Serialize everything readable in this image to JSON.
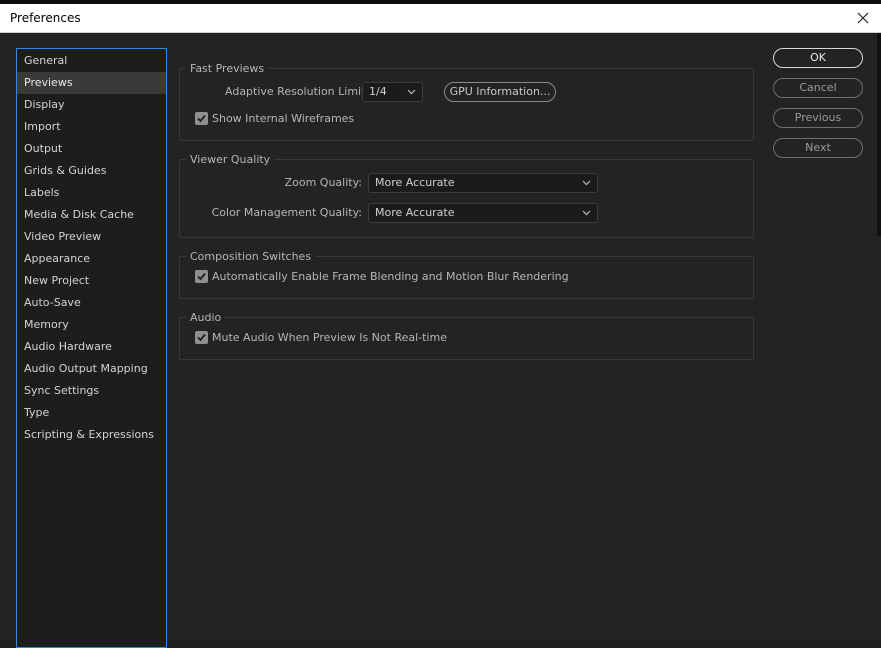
{
  "window": {
    "title": "Preferences"
  },
  "sidebar": {
    "items": [
      {
        "label": "General"
      },
      {
        "label": "Previews"
      },
      {
        "label": "Display"
      },
      {
        "label": "Import"
      },
      {
        "label": "Output"
      },
      {
        "label": "Grids & Guides"
      },
      {
        "label": "Labels"
      },
      {
        "label": "Media & Disk Cache"
      },
      {
        "label": "Video Preview"
      },
      {
        "label": "Appearance"
      },
      {
        "label": "New Project"
      },
      {
        "label": "Auto-Save"
      },
      {
        "label": "Memory"
      },
      {
        "label": "Audio Hardware"
      },
      {
        "label": "Audio Output Mapping"
      },
      {
        "label": "Sync Settings"
      },
      {
        "label": "Type"
      },
      {
        "label": "Scripting & Expressions"
      }
    ],
    "selected_index": 1
  },
  "fast_previews": {
    "legend": "Fast Previews",
    "resolution_label": "Adaptive Resolution Limit:",
    "resolution_value": "1/4",
    "gpu_button": "GPU Information...",
    "wireframes_label": "Show Internal Wireframes",
    "wireframes_checked": true
  },
  "viewer_quality": {
    "legend": "Viewer Quality",
    "zoom_label": "Zoom Quality:",
    "zoom_value": "More Accurate",
    "color_label": "Color Management Quality:",
    "color_value": "More Accurate"
  },
  "composition_switches": {
    "legend": "Composition Switches",
    "frame_blending_label": "Automatically Enable Frame Blending and Motion Blur Rendering",
    "frame_blending_checked": true
  },
  "audio": {
    "legend": "Audio",
    "mute_label": "Mute Audio When Preview Is Not Real-time",
    "mute_checked": true
  },
  "buttons": {
    "ok": "OK",
    "cancel": "Cancel",
    "previous": "Previous",
    "next": "Next"
  },
  "colors": {
    "accent": "#2d8ceb",
    "panel_bg": "#232323",
    "selected_bg": "#3a3a3a"
  }
}
